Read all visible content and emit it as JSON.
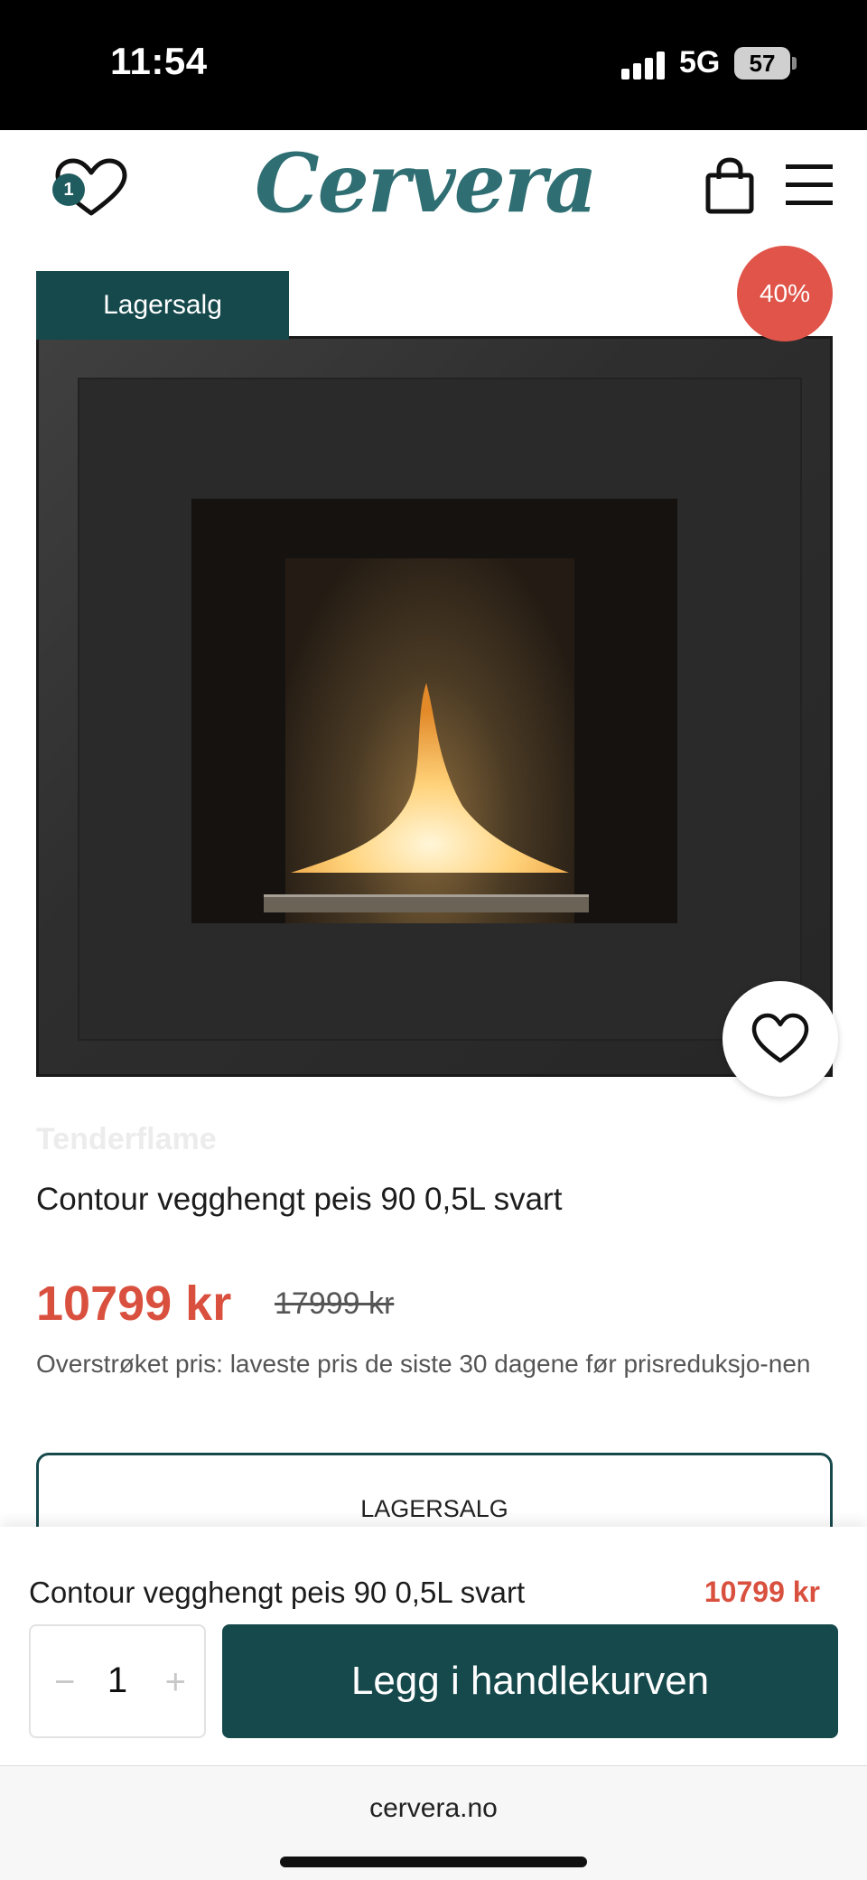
{
  "status": {
    "time": "11:54",
    "network": "5G",
    "battery": "57"
  },
  "header": {
    "wishlist_count": "1",
    "logo": "Cervera"
  },
  "product": {
    "badge": "Lagersalg",
    "discount": "40%",
    "brand": "Tenderflame",
    "title": "Contour vegghengt peis 90 0,5L svart",
    "price": "10799 kr",
    "old_price": "17999 kr",
    "price_note": "Overstrøket pris: laveste pris de siste 30 dagene før prisreduksjo-nen",
    "variant": "LAGERSALG"
  },
  "sticky": {
    "title": "Contour vegghengt peis 90 0,5L svart",
    "price": "10799 kr",
    "quantity": "1",
    "minus": "−",
    "plus": "+",
    "add_button": "Legg i handlekurven"
  },
  "browser": {
    "url": "cervera.no"
  },
  "colors": {
    "brand_teal": "#16494c",
    "sale_red": "#d9503f",
    "logo": "#2f6e72"
  }
}
